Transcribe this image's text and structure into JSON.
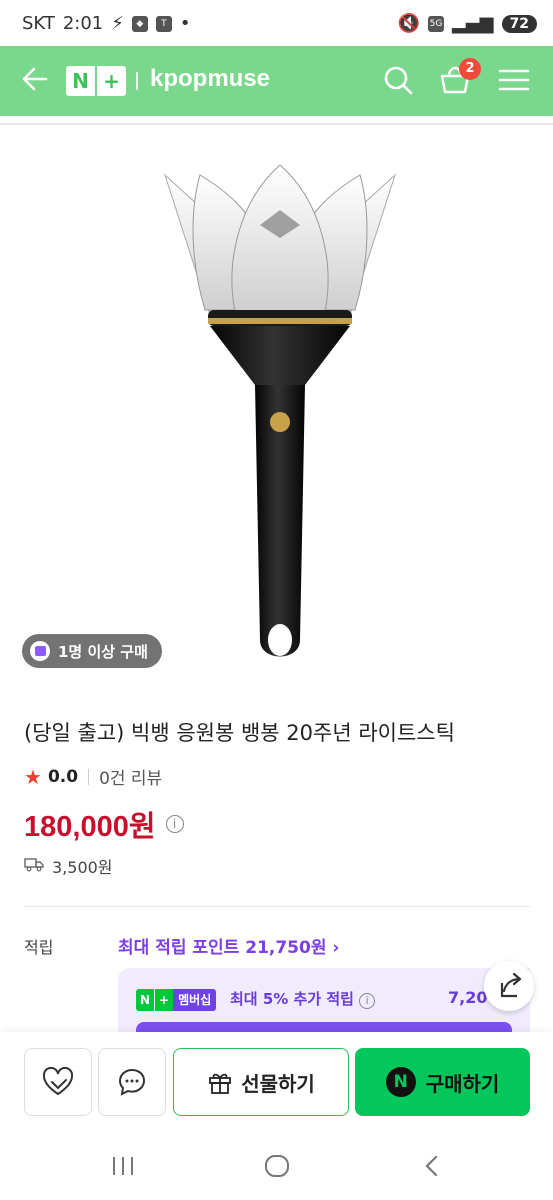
{
  "status_bar": {
    "carrier": "SKT",
    "time": "2:01",
    "battery": "72",
    "network": "5G"
  },
  "header": {
    "brand_n": "N",
    "brand_plus": "+",
    "store_name": "kpopmuse",
    "cart_count": "2",
    "bg_color": "#7ad88c"
  },
  "product": {
    "buy_count_badge": "1명 이상 구매",
    "title": "(당일 출고) 빅뱅 응원봉 뱅봉 20주년 라이트스틱",
    "rating": "0.0",
    "review_count": "0건 리뷰",
    "price": "180,000원",
    "price_color": "#c8102e",
    "shipping_fee": "3,500원"
  },
  "rewards": {
    "label": "적립",
    "max_points_link": "최대 적립 포인트 21,750원",
    "membership_badge": {
      "n": "N",
      "plus": "+",
      "label": "멤버십"
    },
    "membership_text": "최대 5% 추가 적립",
    "membership_amount": "7,20"
  },
  "bottom_bar": {
    "gift_label": "선물하기",
    "buy_label": "구매하기",
    "buy_logo": "N"
  },
  "icons": [
    "back-arrow-icon",
    "search-icon",
    "cart-icon",
    "menu-icon",
    "share-icon",
    "heart-icon",
    "chat-icon",
    "gift-icon"
  ]
}
